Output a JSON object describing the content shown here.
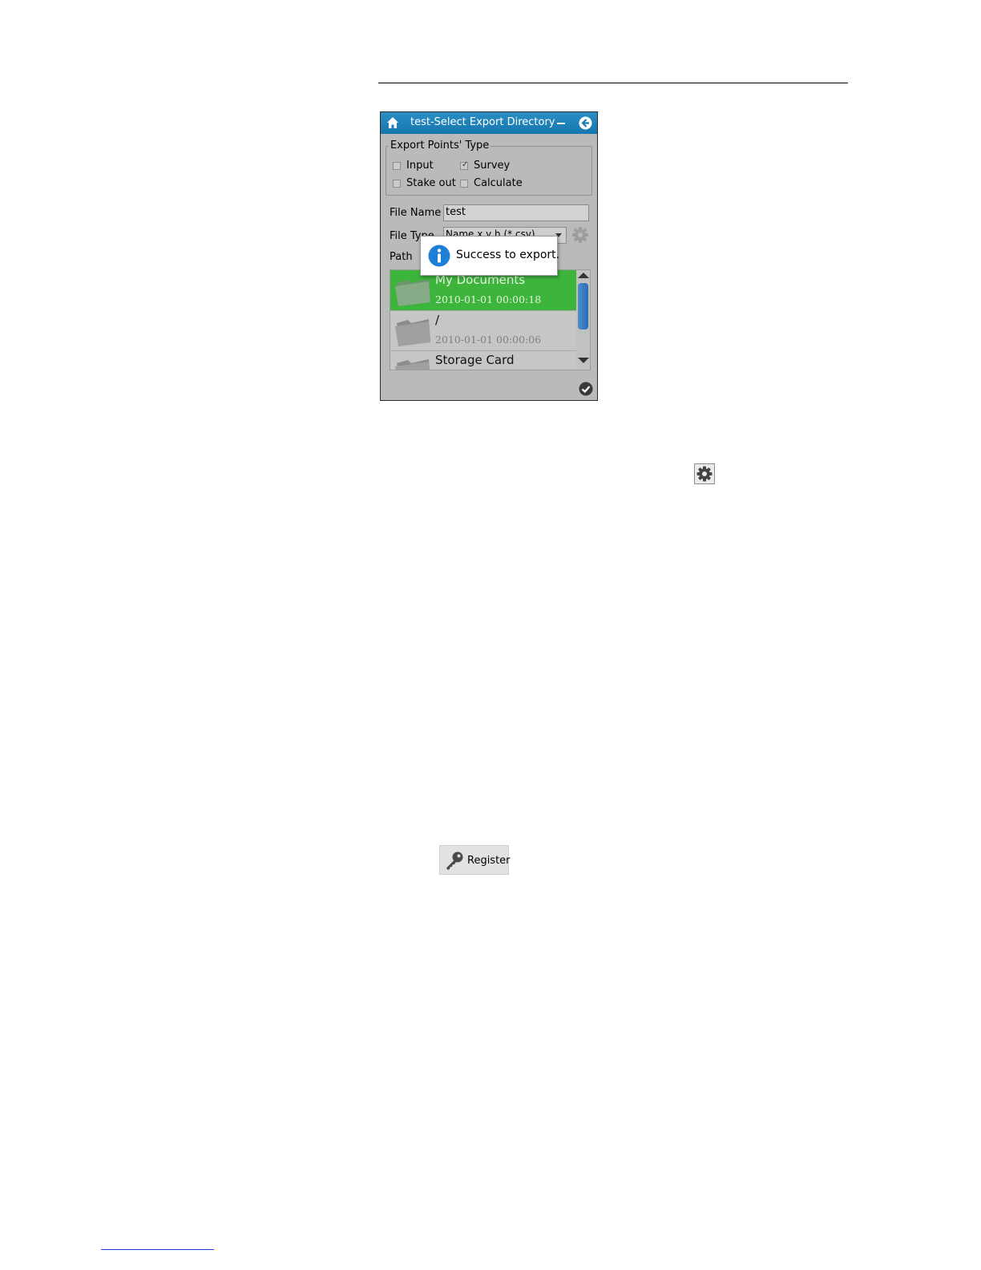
{
  "window": {
    "title": "test-Select Export Directory",
    "icons": {
      "home": "home-icon",
      "minimize": "minimize-icon",
      "back": "back-arrow-icon",
      "confirm": "confirm-check-icon"
    },
    "colors": {
      "titlebar": "#1e83bb",
      "selected_row": "#3db53d",
      "body": "#b8bbb8"
    }
  },
  "export_points_type": {
    "title": "Export Points' Type",
    "options": [
      {
        "label": "Input",
        "checked": false
      },
      {
        "label": "Survey",
        "checked": true
      },
      {
        "label": "Stake out",
        "checked": false
      },
      {
        "label": "Calculate",
        "checked": false
      }
    ]
  },
  "file_name": {
    "label": "File Name",
    "value": "test"
  },
  "file_type": {
    "label": "File Type",
    "value": "Name,x,y,h (*.csv)"
  },
  "path": {
    "label": "Path"
  },
  "directory_list": [
    {
      "name": "My Documents",
      "date": "2010-01-01 00:00:18",
      "selected": true
    },
    {
      "name": "/",
      "date": "2010-01-01 00:00:06",
      "selected": false
    },
    {
      "name": "Storage Card",
      "date": "",
      "selected": false
    }
  ],
  "toast": {
    "message": "Success to export.",
    "icon": "info-icon"
  },
  "doc_icons": {
    "settings": "gear-icon",
    "register_label": "Register",
    "register_icon": "key-icon"
  }
}
